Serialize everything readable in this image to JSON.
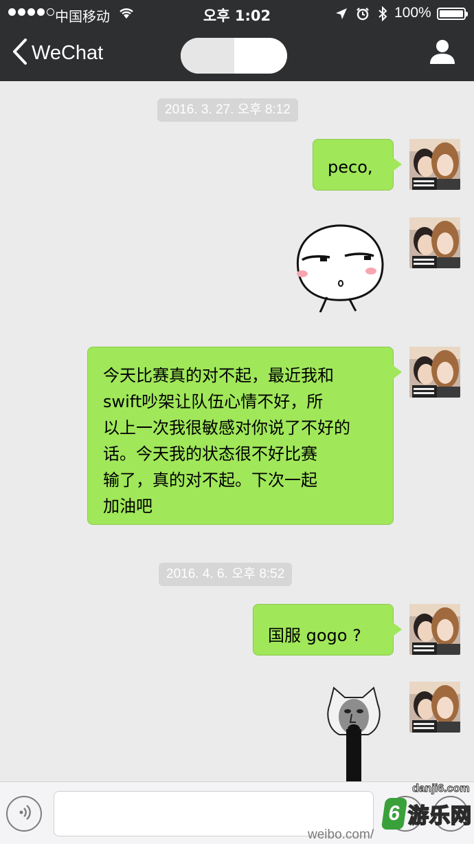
{
  "status_bar": {
    "carrier": "中国移动",
    "time": "오후 1:02",
    "battery": "100%"
  },
  "nav": {
    "back_label": "WeChat",
    "back_icon": "chevron-left-icon",
    "profile_icon": "person-icon"
  },
  "messages": [
    {
      "type": "timestamp",
      "text": "2016. 3. 27. 오후 8:12"
    },
    {
      "type": "text",
      "side": "right",
      "text": "peco,"
    },
    {
      "type": "sticker",
      "side": "right",
      "description_icon": "smug-face-sticker"
    },
    {
      "type": "text",
      "side": "right",
      "lines": [
        "今天比赛真的对不起，最近我和",
        "swift吵架让队伍心情不好，所",
        "以上一次我很敏感对你说了不好的",
        "话。今天我的状态很不好比赛",
        "输了，真的对不起。下次一起",
        "加油吧"
      ]
    },
    {
      "type": "timestamp",
      "text": "2016. 4. 6. 오후 8:52"
    },
    {
      "type": "text",
      "side": "right",
      "text": "国服 gogo ?"
    },
    {
      "type": "sticker",
      "side": "right",
      "description_icon": "meme-face-sticker"
    }
  ],
  "watermarks": {
    "site_badge": "6",
    "site_name": "游乐网",
    "site_url": "danji6.com",
    "weibo": "weibo.com/"
  },
  "colors": {
    "nav_bg": "#2e2f31",
    "chat_bg": "#ebebeb",
    "bubble_green": "#a0e75a",
    "timestamp_bg": "#d6d6d6"
  }
}
